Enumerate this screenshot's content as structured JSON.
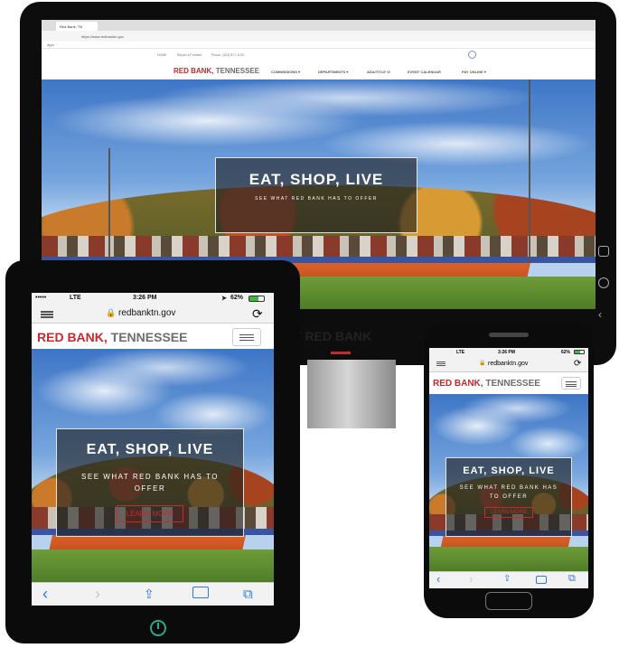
{
  "brand": {
    "red": "RED BANK,",
    "grey": "TENNESSEE",
    "red_color": "#c9282d"
  },
  "hero": {
    "title": "EAT, SHOP, LIVE",
    "subtitle": "SEE WHAT RED BANK HAS TO OFFER",
    "button": "LEARN MORE"
  },
  "monitor": {
    "tab_title": "Red Bank, TN",
    "url": "https://www.redbanktn.gov",
    "bookmarks": "Apps",
    "utility": [
      "HOME",
      "Report a Problem",
      "Phone: (423) 877-1103"
    ],
    "menu": [
      "COMMISSIONS ▾",
      "DEPARTMENTS ▾",
      "ADA/TITLE VI",
      "EVENT CALENDAR",
      "PAY ONLINE ▾"
    ],
    "below_hero": "T RED BANK"
  },
  "tablet": {
    "carrier": "LTE",
    "time": "3:26 PM",
    "battery": "62%",
    "url": "redbanktn.gov"
  },
  "phone": {
    "carrier": "LTE",
    "time": "3:26 PM",
    "battery": "62%",
    "url": "redbanktn.gov"
  },
  "icons": {
    "reload": "⟳",
    "lock": "🔒",
    "back": "‹",
    "forward": "›",
    "share": "⇪",
    "book": "📖",
    "tabs": "⧉",
    "location": "➤"
  }
}
